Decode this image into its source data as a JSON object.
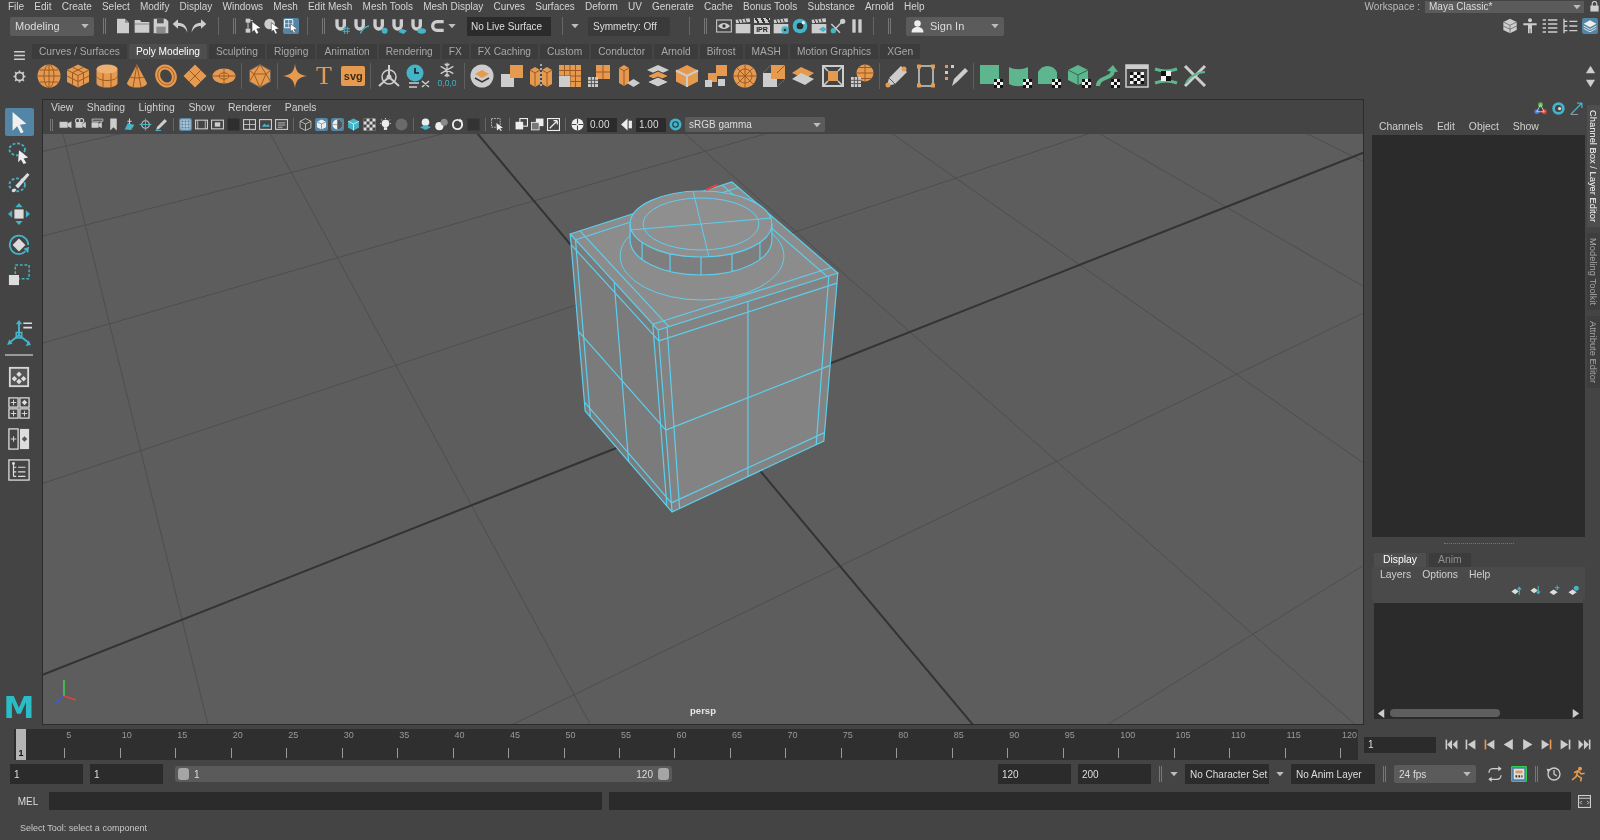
{
  "menu_bar": {
    "items": [
      "File",
      "Edit",
      "Create",
      "Select",
      "Modify",
      "Display",
      "Windows",
      "Mesh",
      "Edit Mesh",
      "Mesh Tools",
      "Mesh Display",
      "Curves",
      "Surfaces",
      "Deform",
      "UV",
      "Generate",
      "Cache",
      "Bonus Tools",
      "Substance",
      "Arnold",
      "Help"
    ],
    "workspace_label": "Workspace :",
    "workspace": "Maya Classic*"
  },
  "status_line": {
    "menu_set": "Modeling",
    "component_select_on": true,
    "live_surface": "No Live Surface",
    "symmetry": "Symmetry: Off",
    "ipr_label": "IPR",
    "sign_in": "Sign In",
    "channel_box_toggle_on": true
  },
  "shelf": {
    "tabs": [
      {
        "label": "Curves / Surfaces",
        "selected": false
      },
      {
        "label": "Poly Modeling",
        "selected": true
      },
      {
        "label": "Sculpting",
        "selected": false
      },
      {
        "label": "Rigging",
        "selected": false
      },
      {
        "label": "Animation",
        "selected": false
      },
      {
        "label": "Rendering",
        "selected": false
      },
      {
        "label": "FX",
        "selected": false
      },
      {
        "label": "FX Caching",
        "selected": false
      },
      {
        "label": "Custom",
        "selected": false
      },
      {
        "label": "Conductor",
        "selected": false
      },
      {
        "label": "Arnold",
        "selected": false
      },
      {
        "label": "Bifrost",
        "selected": false
      },
      {
        "label": "MASH",
        "selected": false
      },
      {
        "label": "Motion Graphics",
        "selected": false
      },
      {
        "label": "XGen",
        "selected": false
      }
    ],
    "text_tool_glyph": "T",
    "svg_tool_label": "svg",
    "freeze_label": "0,0,0"
  },
  "toolbox": {
    "tools": [
      {
        "kind": "select",
        "selected": true
      },
      {
        "kind": "lasso",
        "selected": false
      },
      {
        "kind": "paint",
        "selected": false
      },
      {
        "kind": "move",
        "selected": false
      },
      {
        "kind": "rotate",
        "selected": false
      },
      {
        "kind": "scale",
        "selected": false
      }
    ],
    "logo": "M"
  },
  "viewport": {
    "menus": [
      "View",
      "Shading",
      "Lighting",
      "Show",
      "Renderer",
      "Panels"
    ],
    "grid_on": true,
    "smooth_shade_on": true,
    "wireframe_on_shaded_on": true,
    "exposure": "0.00",
    "gamma": "1.00",
    "color_space": "sRGB gamma",
    "camera": "persp"
  },
  "channel_box": {
    "menus": [
      "Channels",
      "Edit",
      "Object",
      "Show"
    ]
  },
  "layer_editor": {
    "tabs": [
      {
        "label": "Display",
        "selected": true
      },
      {
        "label": "Anim",
        "selected": false
      }
    ],
    "menus": [
      "Layers",
      "Options",
      "Help"
    ]
  },
  "side_tabs": [
    {
      "label": "Channel Box / Layer Editor",
      "selected": true
    },
    {
      "label": "Modeling Toolkit",
      "selected": false
    },
    {
      "label": "Attribute Editor",
      "selected": false
    }
  ],
  "time_slider": {
    "current_frame": "1",
    "level": 0,
    "tick_labels": [
      "5",
      "10",
      "15",
      "20",
      "25",
      "30",
      "35",
      "40",
      "45",
      "50",
      "55",
      "60",
      "65",
      "70",
      "75",
      "80",
      "85",
      "90",
      "95",
      "100",
      "105",
      "110",
      "115",
      "120"
    ],
    "frame_field": "1"
  },
  "range_slider": {
    "start_field": "1",
    "playback_start_field": "1",
    "range_start": "1",
    "range_end": "120",
    "handles": [
      {
        "level": 0
      },
      {
        "level": 1
      }
    ],
    "playback_end_field": "120",
    "end_field": "200",
    "character_set": "No Character Set",
    "anim_layer": "No Anim Layer",
    "fps": "24 fps",
    "keyframe_toggle_on": true
  },
  "command_line": {
    "language": "MEL"
  },
  "help_line": "Select Tool: select a component"
}
